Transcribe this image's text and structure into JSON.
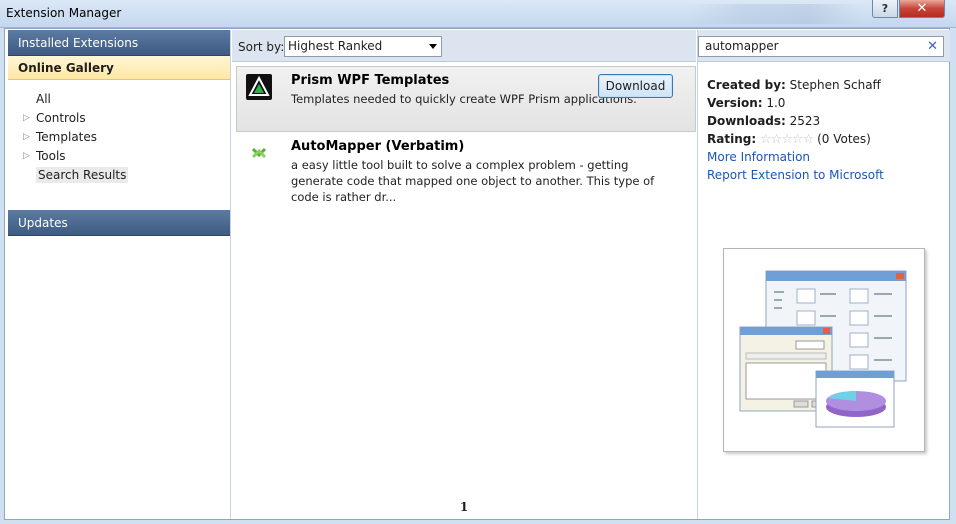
{
  "window": {
    "title": "Extension Manager",
    "help_label": "?",
    "close_label": "✕"
  },
  "sidebar": {
    "installed": "Installed Extensions",
    "online": "Online Gallery",
    "tree": [
      {
        "label": "All",
        "expandable": false
      },
      {
        "label": "Controls",
        "expandable": true
      },
      {
        "label": "Templates",
        "expandable": true
      },
      {
        "label": "Tools",
        "expandable": true
      },
      {
        "label": "Search Results",
        "expandable": false,
        "selected": true
      }
    ],
    "updates": "Updates"
  },
  "toolbar": {
    "sort_label": "Sort by:",
    "sort_value": "Highest Ranked"
  },
  "search": {
    "value": "automapper",
    "clear_icon": "✕"
  },
  "extensions": [
    {
      "title": "Prism WPF Templates",
      "desc": "Templates needed to quickly create WPF Prism applications.",
      "icon": "prism-template-icon",
      "download_label": "Download",
      "selected": true
    },
    {
      "title": "AutoMapper (Verbatim)",
      "desc": "a easy little tool built to solve a complex problem - getting generate code that mapped one object to another. This type of code is rather dr...",
      "icon": "automapper-icon"
    }
  ],
  "pager": {
    "current": "1"
  },
  "detail": {
    "created_by_label": "Created by:",
    "created_by": "Stephen Schaff",
    "version_label": "Version:",
    "version": "1.0",
    "downloads_label": "Downloads:",
    "downloads": "2523",
    "rating_label": "Rating:",
    "rating_stars": 0,
    "votes": "(0 Votes)",
    "more_info": "More Information",
    "report": "Report Extension to Microsoft"
  }
}
